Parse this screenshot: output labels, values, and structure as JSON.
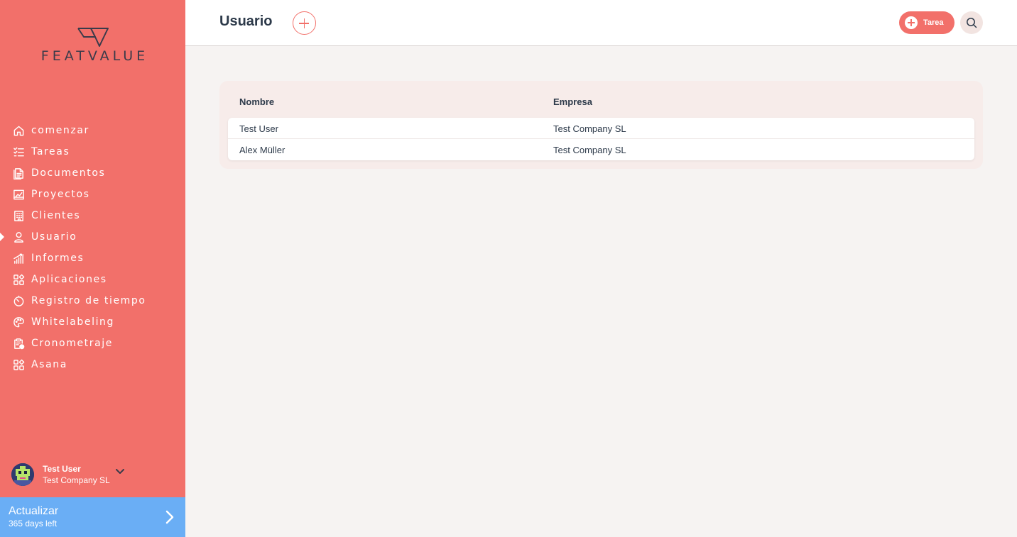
{
  "brand": {
    "logo_text": "FEATVALUE"
  },
  "colors": {
    "sidebar": "#f2706a",
    "upgrade": "#6aaef5",
    "text": "#2d3a4a"
  },
  "sidebar": {
    "items": [
      {
        "label": "comenzar",
        "icon": "home-icon"
      },
      {
        "label": "Tareas",
        "icon": "checklist-icon"
      },
      {
        "label": "Documentos",
        "icon": "document-icon"
      },
      {
        "label": "Proyectos",
        "icon": "chart-icon"
      },
      {
        "label": "Clientes",
        "icon": "building-icon"
      },
      {
        "label": "Usuario",
        "icon": "user-icon",
        "active": true
      },
      {
        "label": "Informes",
        "icon": "bar-chart-icon"
      },
      {
        "label": "Aplicaciones",
        "icon": "apps-icon"
      },
      {
        "label": "Registro de tiempo",
        "icon": "timer-icon"
      },
      {
        "label": "Whitelabeling",
        "icon": "palette-icon"
      },
      {
        "label": "Cronometraje",
        "icon": "clipboard-clock-icon"
      },
      {
        "label": "Asana",
        "icon": "apps-icon"
      }
    ],
    "user": {
      "name": "Test User",
      "company": "Test Company SL"
    },
    "upgrade": {
      "title": "Actualizar",
      "subtitle": "365 days left"
    }
  },
  "header": {
    "title": "Usuario",
    "task_button": "Tarea"
  },
  "table": {
    "columns": [
      "Nombre",
      "Empresa"
    ],
    "rows": [
      [
        "Test User",
        "Test Company SL"
      ],
      [
        "Alex Müller",
        "Test Company SL"
      ]
    ]
  }
}
